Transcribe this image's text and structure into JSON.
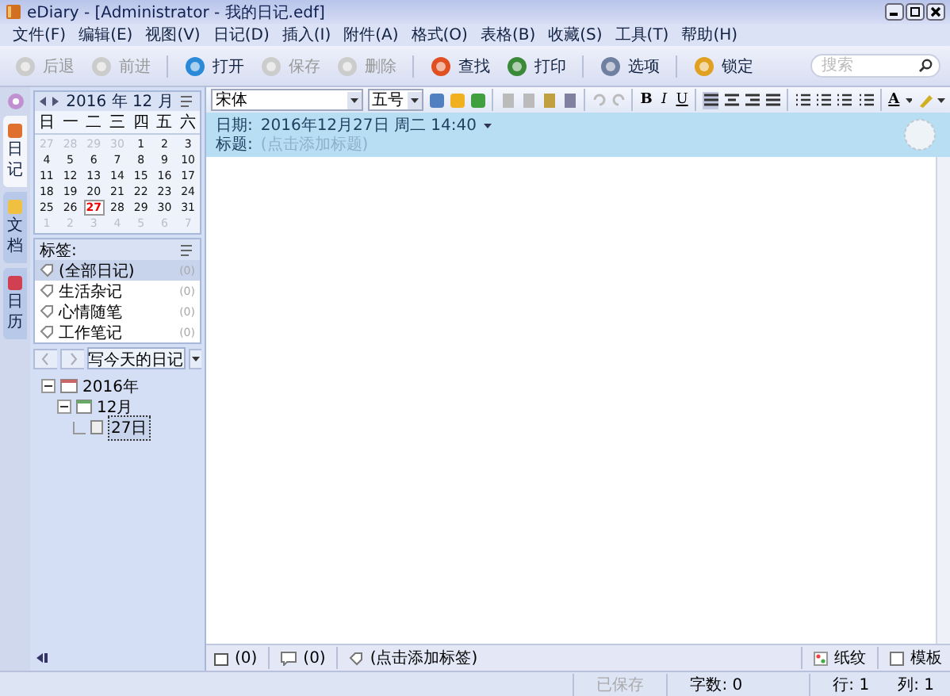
{
  "window": {
    "title": "eDiary - [Administrator - 我的日记.edf]"
  },
  "menu": [
    "文件(F)",
    "编辑(E)",
    "视图(V)",
    "日记(D)",
    "插入(I)",
    "附件(A)",
    "格式(O)",
    "表格(B)",
    "收藏(S)",
    "工具(T)",
    "帮助(H)"
  ],
  "toolbar": [
    {
      "label": "后退",
      "disabled": true,
      "kind": "back"
    },
    {
      "label": "前进",
      "disabled": true,
      "kind": "forward"
    },
    {
      "label": "打开",
      "disabled": false,
      "kind": "open"
    },
    {
      "label": "保存",
      "disabled": true,
      "kind": "save"
    },
    {
      "label": "删除",
      "disabled": true,
      "kind": "delete"
    },
    {
      "label": "查找",
      "disabled": false,
      "kind": "find"
    },
    {
      "label": "打印",
      "disabled": false,
      "kind": "print"
    },
    {
      "label": "选项",
      "disabled": false,
      "kind": "options"
    },
    {
      "label": "锁定",
      "disabled": false,
      "kind": "lock"
    }
  ],
  "search": {
    "placeholder": "搜索"
  },
  "side_tabs": [
    {
      "label": "日记",
      "selected": true
    },
    {
      "label": "文档",
      "selected": false
    },
    {
      "label": "日历",
      "selected": false
    }
  ],
  "calendar": {
    "year": "2016",
    "year_unit": "年",
    "month": "12",
    "month_unit": "月",
    "weekdays": [
      "日",
      "一",
      "二",
      "三",
      "四",
      "五",
      "六"
    ],
    "weeks": [
      [
        {
          "d": "27",
          "other": true,
          "selected": false
        },
        {
          "d": "28",
          "other": true,
          "selected": false
        },
        {
          "d": "29",
          "other": true,
          "selected": false
        },
        {
          "d": "30",
          "other": true,
          "selected": false
        },
        {
          "d": "1",
          "other": false,
          "selected": false
        },
        {
          "d": "2",
          "other": false,
          "selected": false
        },
        {
          "d": "3",
          "other": false,
          "selected": false
        }
      ],
      [
        {
          "d": "4",
          "other": false,
          "selected": false
        },
        {
          "d": "5",
          "other": false,
          "selected": false
        },
        {
          "d": "6",
          "other": false,
          "selected": false
        },
        {
          "d": "7",
          "other": false,
          "selected": false
        },
        {
          "d": "8",
          "other": false,
          "selected": false
        },
        {
          "d": "9",
          "other": false,
          "selected": false
        },
        {
          "d": "10",
          "other": false,
          "selected": false
        }
      ],
      [
        {
          "d": "11",
          "other": false,
          "selected": false
        },
        {
          "d": "12",
          "other": false,
          "selected": false
        },
        {
          "d": "13",
          "other": false,
          "selected": false
        },
        {
          "d": "14",
          "other": false,
          "selected": false
        },
        {
          "d": "15",
          "other": false,
          "selected": false
        },
        {
          "d": "16",
          "other": false,
          "selected": false
        },
        {
          "d": "17",
          "other": false,
          "selected": false
        }
      ],
      [
        {
          "d": "18",
          "other": false,
          "selected": false
        },
        {
          "d": "19",
          "other": false,
          "selected": false
        },
        {
          "d": "20",
          "other": false,
          "selected": false
        },
        {
          "d": "21",
          "other": false,
          "selected": false
        },
        {
          "d": "22",
          "other": false,
          "selected": false
        },
        {
          "d": "23",
          "other": false,
          "selected": false
        },
        {
          "d": "24",
          "other": false,
          "selected": false
        }
      ],
      [
        {
          "d": "25",
          "other": false,
          "selected": false
        },
        {
          "d": "26",
          "other": false,
          "selected": false
        },
        {
          "d": "27",
          "other": false,
          "selected": true
        },
        {
          "d": "28",
          "other": false,
          "selected": false
        },
        {
          "d": "29",
          "other": false,
          "selected": false
        },
        {
          "d": "30",
          "other": false,
          "selected": false
        },
        {
          "d": "31",
          "other": false,
          "selected": false
        }
      ],
      [
        {
          "d": "1",
          "other": true,
          "selected": false
        },
        {
          "d": "2",
          "other": true,
          "selected": false
        },
        {
          "d": "3",
          "other": true,
          "selected": false
        },
        {
          "d": "4",
          "other": true,
          "selected": false
        },
        {
          "d": "5",
          "other": true,
          "selected": false
        },
        {
          "d": "6",
          "other": true,
          "selected": false
        },
        {
          "d": "7",
          "other": true,
          "selected": false
        }
      ]
    ]
  },
  "tags": {
    "title": "标签:",
    "items": [
      {
        "label": "(全部日记)",
        "count": "(0)",
        "selected": true
      },
      {
        "label": "生活杂记",
        "count": "(0)",
        "selected": false
      },
      {
        "label": "心情随笔",
        "count": "(0)",
        "selected": false
      },
      {
        "label": "工作笔记",
        "count": "(0)",
        "selected": false
      }
    ]
  },
  "write_today_button": "写今天的日记",
  "tree": [
    {
      "label": "2016年",
      "expanded": true,
      "kind": "year",
      "selected": false,
      "children": [
        {
          "label": "12月",
          "expanded": true,
          "kind": "month",
          "selected": false,
          "children": [
            {
              "label": "27日",
              "kind": "entry",
              "selected": true
            }
          ]
        }
      ]
    }
  ],
  "format": {
    "font": "宋体",
    "size": "五号",
    "bold": "B",
    "italic": "I",
    "underline": "U",
    "font_color": "A"
  },
  "entry": {
    "date_label": "日期:",
    "date": "2016年12月27日  周二  14:40",
    "title_label": "标题:",
    "title_placeholder": "(点击添加标题)"
  },
  "bottom_bar": {
    "attachments": "(0)",
    "comments": "(0)",
    "tags": "(点击添加标签)",
    "paper": "纸纹",
    "template": "模板"
  },
  "status_bar": {
    "saved": "已保存",
    "words": "字数: 0",
    "line": "行: 1",
    "column": "列: 1"
  }
}
